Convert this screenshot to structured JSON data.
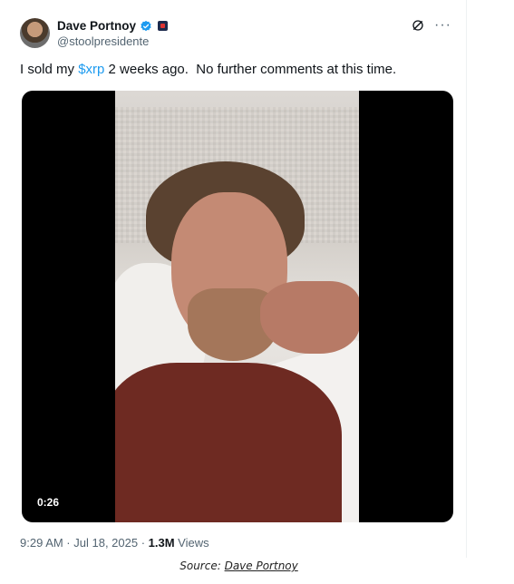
{
  "tweet": {
    "author": {
      "display_name": "Dave Portnoy",
      "handle": "@stoolpresidente",
      "verified": true,
      "avatar_icon": "avatar-photo"
    },
    "header_icons": [
      "grok-icon",
      "more-icon"
    ],
    "more_label": "···",
    "text_before": "I sold my ",
    "cashtag": "$xrp",
    "text_after": " 2 weeks ago.  No further comments at this time.",
    "media": {
      "type": "video",
      "duration": "0:26"
    },
    "meta": {
      "time_date": "9:29 AM · Jul 18, 2025 · ",
      "views_count": "1.3M",
      "views_label": " Views"
    }
  },
  "caption": {
    "prefix": "Source: ",
    "source_name": "Dave Portnoy"
  },
  "colors": {
    "link": "#1d9bf0",
    "text": "#0f1419",
    "muted": "#536471",
    "verified": "#1d9bf0"
  }
}
